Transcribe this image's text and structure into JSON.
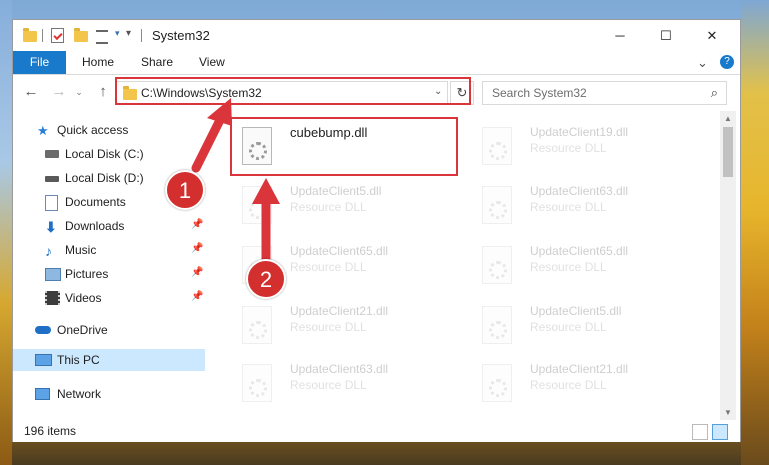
{
  "window": {
    "title": "System32",
    "controls": {
      "minimize": "─",
      "maximize": "☐",
      "close": "✕"
    }
  },
  "ribbon": {
    "file": "File",
    "tabs": [
      "Home",
      "Share",
      "View"
    ],
    "expand": "⌄",
    "help": "?"
  },
  "address": {
    "path": "C:\\Windows\\System32",
    "search_placeholder": "Search System32"
  },
  "nav": {
    "items": [
      {
        "label": "Quick access",
        "icon": "star-icon"
      },
      {
        "label": "Local Disk (C:)",
        "icon": "drive-icon"
      },
      {
        "label": "Local Disk (D:)",
        "icon": "drive-icon"
      },
      {
        "label": "Documents",
        "icon": "documents-icon"
      },
      {
        "label": "Downloads",
        "icon": "download-icon"
      },
      {
        "label": "Music",
        "icon": "music-icon"
      },
      {
        "label": "Pictures",
        "icon": "pictures-icon"
      },
      {
        "label": "Videos",
        "icon": "videos-icon"
      },
      {
        "label": "OneDrive",
        "icon": "cloud-icon"
      },
      {
        "label": "This PC",
        "icon": "computer-icon"
      },
      {
        "label": "Network",
        "icon": "network-icon"
      }
    ]
  },
  "files": {
    "highlighted": {
      "name": "cubebump.dll"
    },
    "tiles": [
      {
        "name": "UpdateClient19.dll",
        "type": "Resource DLL"
      },
      {
        "name": "UpdateClient5.dll",
        "type": "Resource DLL"
      },
      {
        "name": "UpdateClient63.dll",
        "type": "Resource DLL"
      },
      {
        "name": "UpdateClient65.dll",
        "type": "Resource DLL"
      },
      {
        "name": "UpdateClient65.dll",
        "type": "Resource DLL"
      },
      {
        "name": "UpdateClient21.dll",
        "type": "Resource DLL"
      },
      {
        "name": "UpdateClient5.dll",
        "type": "Resource DLL"
      },
      {
        "name": "UpdateClient63.dll",
        "type": "Resource DLL"
      },
      {
        "name": "UpdateClient21.dll",
        "type": "Resource DLL"
      }
    ]
  },
  "status": {
    "item_count": "196 items"
  },
  "annotations": {
    "badge1": "1",
    "badge2": "2",
    "color": "#d9353a"
  }
}
